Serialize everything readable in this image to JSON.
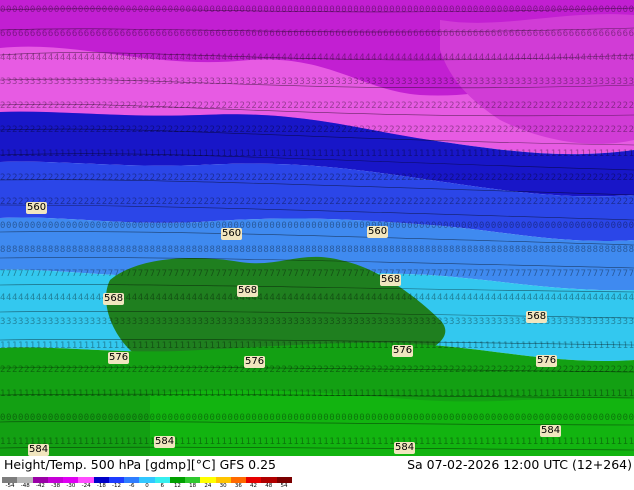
{
  "footer": {
    "left_text": "Height/Temp. 500 hPa [gdmp][°C] GFS 0.25",
    "right_text": "Sa 07-02-2026 12:00 UTC (12+264)"
  },
  "legend": {
    "ticks": [
      "-54",
      "-48",
      "-42",
      "-38",
      "-30",
      "-24",
      "-18",
      "-12",
      "-6",
      "0",
      "6",
      "12",
      "18",
      "24",
      "30",
      "36",
      "42",
      "48",
      "54"
    ],
    "colors": [
      "#7d7d7d",
      "#b7b7b7",
      "#9a00a6",
      "#c500d6",
      "#e000f3",
      "#ff4cff",
      "#0000c8",
      "#1e3cff",
      "#2f7dff",
      "#31c7ff",
      "#36efef",
      "#00a000",
      "#2ec92e",
      "#ffff00",
      "#ffc400",
      "#ff6a00",
      "#e60000",
      "#b00000",
      "#7a0000"
    ]
  },
  "contour_labels": [
    "560",
    "560",
    "560",
    "568",
    "568",
    "568",
    "568",
    "576",
    "576",
    "576",
    "576",
    "584",
    "584",
    "584",
    "584"
  ],
  "map": {
    "colors": {
      "magenta": "#c21fd2",
      "pink": "#e75be3",
      "deep_blue": "#1816c8",
      "blue": "#2b46e8",
      "light_blue": "#3f8af0",
      "cyan": "#33c8ef",
      "dark_green": "#1f7f1f",
      "green": "#13a013",
      "bright_green": "#12b410",
      "contour": "#000000"
    }
  }
}
